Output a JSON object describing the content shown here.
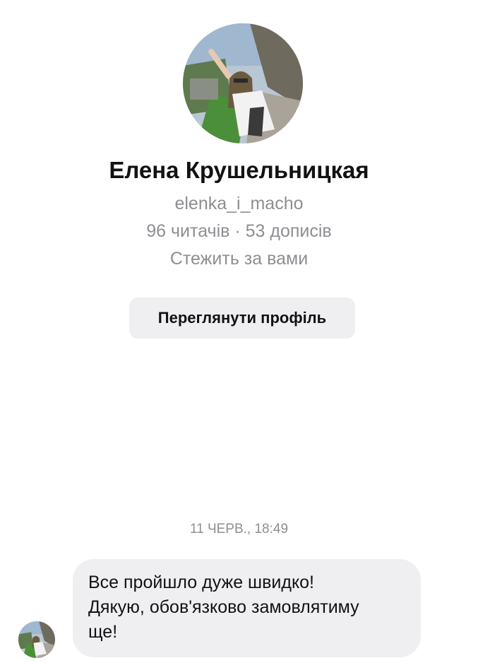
{
  "profile": {
    "name": "Елена Крушельницкая",
    "username": "elenka_i_macho",
    "stats": "96 читачів · 53 дописів",
    "follow_status": "Стежить за вами",
    "view_profile_label": "Переглянути профіль"
  },
  "conversation": {
    "timestamp": "11 ЧЕРВ., 18:49",
    "messages": [
      {
        "lines": [
          "Все пройшло дуже швидко!",
          "Дякую, обов'язково замовлятиму",
          "ще!"
        ]
      }
    ]
  },
  "colors": {
    "text_primary": "#121212",
    "text_secondary": "#8e8e93",
    "bubble_bg": "#efeff1",
    "button_bg": "#efeff1"
  }
}
